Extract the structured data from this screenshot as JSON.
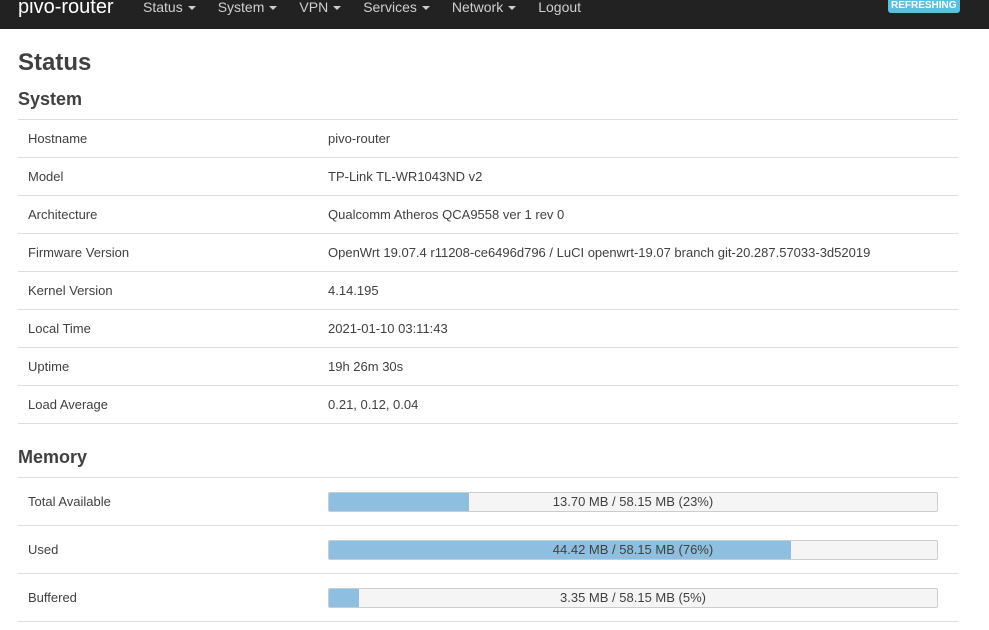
{
  "navbar": {
    "brand": "pivo-router",
    "items": [
      {
        "label": "Status",
        "dropdown": true
      },
      {
        "label": "System",
        "dropdown": true
      },
      {
        "label": "VPN",
        "dropdown": true
      },
      {
        "label": "Services",
        "dropdown": true
      },
      {
        "label": "Network",
        "dropdown": true
      },
      {
        "label": "Logout",
        "dropdown": false
      }
    ],
    "badge": "REFRESHING",
    "badge_color": "#5bc0de"
  },
  "page_title": "Status",
  "system": {
    "title": "System",
    "rows": [
      {
        "key": "Hostname",
        "value": "pivo-router"
      },
      {
        "key": "Model",
        "value": "TP-Link TL-WR1043ND v2"
      },
      {
        "key": "Architecture",
        "value": "Qualcomm Atheros QCA9558 ver 1 rev 0"
      },
      {
        "key": "Firmware Version",
        "value": "OpenWrt 19.07.4 r11208-ce6496d796 / LuCI openwrt-19.07 branch git-20.287.57033-3d52019"
      },
      {
        "key": "Kernel Version",
        "value": "4.14.195"
      },
      {
        "key": "Local Time",
        "value": "2021-01-10 03:11:43"
      },
      {
        "key": "Uptime",
        "value": "19h 26m 30s"
      },
      {
        "key": "Load Average",
        "value": "0.21, 0.12, 0.04"
      }
    ]
  },
  "memory": {
    "title": "Memory",
    "bar_color": "#8ebfe0",
    "rows": [
      {
        "key": "Total Available",
        "text": "13.70 MB / 58.15 MB (23%)",
        "percent": 23
      },
      {
        "key": "Used",
        "text": "44.42 MB / 58.15 MB (76%)",
        "percent": 76
      },
      {
        "key": "Buffered",
        "text": "3.35 MB / 58.15 MB (5%)",
        "percent": 5
      }
    ]
  }
}
